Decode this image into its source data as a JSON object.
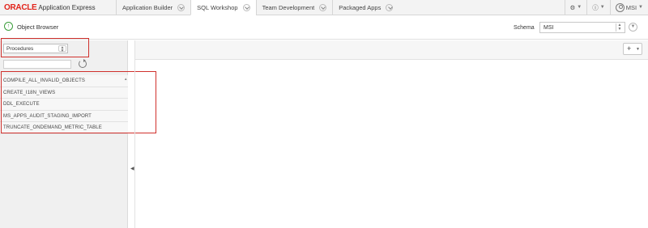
{
  "brand": {
    "oracle": "ORACLE",
    "product": "Application Express"
  },
  "nav": {
    "tabs": [
      {
        "label": "Application Builder",
        "active": false
      },
      {
        "label": "SQL Workshop",
        "active": true
      },
      {
        "label": "Team Development",
        "active": false
      },
      {
        "label": "Packaged Apps",
        "active": false
      }
    ],
    "user": "MSI"
  },
  "page": {
    "title": "Object Browser"
  },
  "schema": {
    "label": "Schema",
    "value": "MSI"
  },
  "object_type": {
    "selected": "Procedures"
  },
  "objects": [
    "COMPILE_ALL_INVALID_OBJECTS",
    "CREATE_I18N_VIEWS",
    "DDL_EXECUTE",
    "MS_APPS_AUDIT_STAGING_IMPORT",
    "TRUNCATE_ONDEMAND_METRIC_TABLE"
  ],
  "icons": {
    "object_browser": "object-browser-icon",
    "refresh": "refresh-icon",
    "add": "plus-icon",
    "help": "help-icon",
    "admin": "admin-icon",
    "user": "user-icon"
  },
  "colors": {
    "highlight": "#d0312d",
    "brand_red": "#e2231a",
    "accent_green": "#3a9d3a"
  }
}
